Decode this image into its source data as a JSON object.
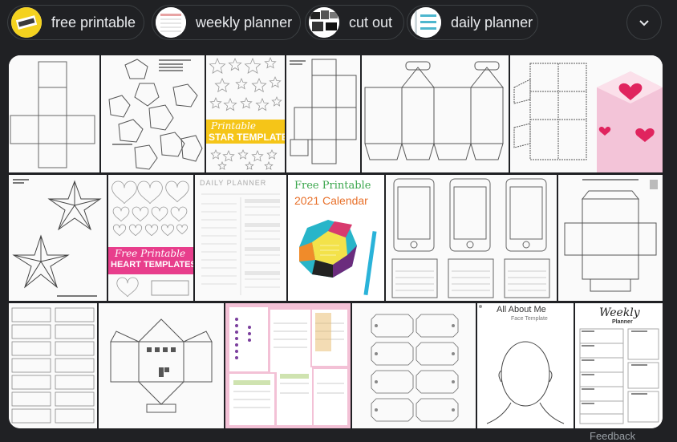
{
  "chips": [
    {
      "label": "free printable",
      "icon": "free-printable-thumbnail"
    },
    {
      "label": "weekly planner",
      "icon": "weekly-planner-thumbnail"
    },
    {
      "label": "cut out",
      "icon": "cut-out-thumbnail"
    },
    {
      "label": "daily planner",
      "icon": "daily-planner-thumbnail"
    }
  ],
  "more_button": {
    "icon": "chevron-down-icon"
  },
  "tiles": {
    "star_templates": {
      "line1": "Printable",
      "line2": "STAR TEMPLATES",
      "accent": "#f5c518"
    },
    "heart_templates": {
      "line1": "Free Printable",
      "line2": "HEART TEMPLATES",
      "accent": "#e83e8c"
    },
    "daily_planner": {
      "title": "DAILY PLANNER"
    },
    "calendar": {
      "line1": "Free Printable",
      "line2": "2021 Calendar",
      "line1_color": "#3aa64c",
      "line2_color": "#e8702a"
    },
    "about_me": {
      "title": "All About Me",
      "subtitle": "Face Template"
    },
    "weekly_planner": {
      "title": "Weekly",
      "subtitle": "Planner"
    }
  },
  "footer": {
    "text": "Feedback"
  }
}
